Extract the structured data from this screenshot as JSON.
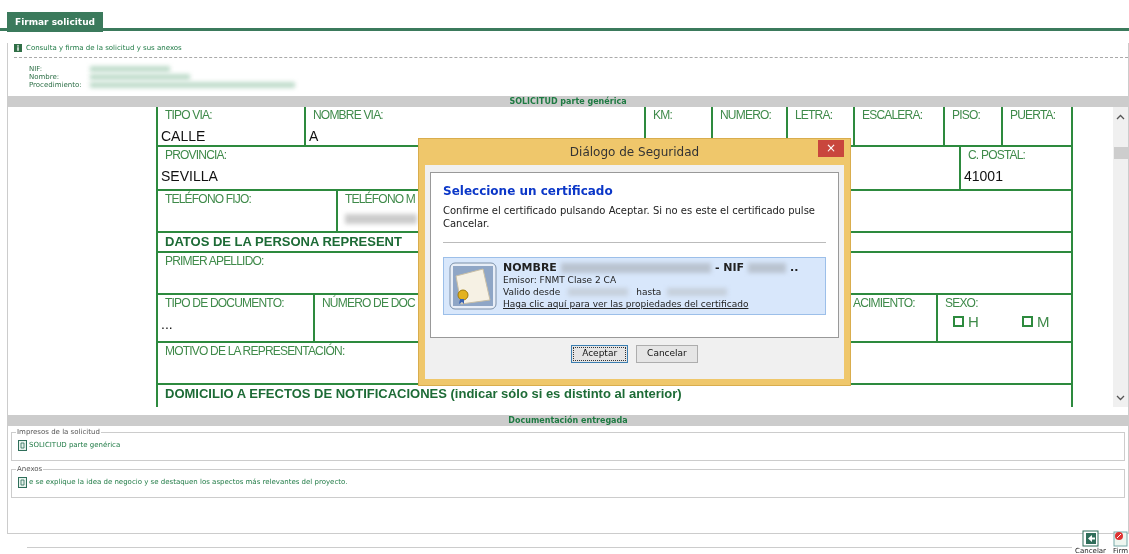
{
  "tab": {
    "label": "Firmar solicitud",
    "selected": true
  },
  "info": {
    "title": "Consulta y firma de la solicitud y sus anexos"
  },
  "applicant": {
    "labels": [
      "NIF:",
      "Nombre:",
      "Procedimiento:"
    ]
  },
  "section_header": "SOLICITUD parte genérica",
  "form": {
    "lines": [
      [
        {
          "kind": "field",
          "label": "TIPO VIA:",
          "value": "CALLE"
        },
        {
          "kind": "field",
          "label": "NOMBRE VIA:",
          "value": "A"
        },
        {
          "kind": "field",
          "label": "KM:"
        },
        {
          "kind": "field",
          "label": "NUMERO:"
        },
        {
          "kind": "field",
          "label": "LETRA:"
        },
        {
          "kind": "field",
          "label": "ESCALERA:"
        },
        {
          "kind": "field",
          "label": "PISO:"
        },
        {
          "kind": "field",
          "label": "PUERTA:"
        }
      ],
      [
        {
          "kind": "field",
          "label": "PROVINCIA:",
          "value": "SEVILLA"
        },
        {
          "kind": "field",
          "label": "C. POSTAL:",
          "value": "41001"
        }
      ],
      [
        {
          "kind": "field",
          "label": "TELÉFONO FIJO:"
        },
        {
          "kind": "redacted",
          "label": "TELÉFONO M"
        }
      ],
      [
        {
          "kind": "heading",
          "label": "DATOS DE LA PERSONA REPRESENT"
        }
      ],
      [
        {
          "kind": "field",
          "label": "PRIMER APELLIDO:"
        }
      ],
      [
        {
          "kind": "field",
          "label": "TIPO DE DOCUMENTO:",
          "value": "..."
        },
        {
          "kind": "field",
          "label": "NÚMERO DE DOC"
        },
        {
          "kind": "field",
          "label": "ACIMIENTO:"
        },
        {
          "kind": "checks",
          "label": "SEXO:",
          "options": [
            {
              "label": "H",
              "checked": false
            },
            {
              "label": "M",
              "checked": false
            }
          ]
        }
      ],
      [
        {
          "kind": "field",
          "label": "MOTIVO DE LA REPRESENTACIÓN:"
        }
      ],
      [
        {
          "kind": "heading",
          "label": "DOMICILIO A EFECTOS DE NOTIFICACIONES (indicar sólo si es distinto al anterior)"
        }
      ]
    ]
  },
  "dialog": {
    "title": "Diálogo de Seguridad",
    "close": "×",
    "heading": "Seleccione un certificado",
    "message": "Confirme el certificado pulsando Aceptar. Si no es este el certificado pulse Cancelar.",
    "certificate": {
      "name_label": "NOMBRE",
      "nif_label": "- NIF",
      "ellipsis": "..",
      "issuer": "Emisor: FNMT Clase 2 CA",
      "valid_from": "Valido desde",
      "valid_to": "hasta",
      "link": "Haga clic aquí para ver las propiedades del certificado"
    },
    "buttons": [
      {
        "label": "Aceptar",
        "focused": true
      },
      {
        "label": "Cancelar",
        "focused": false
      }
    ]
  },
  "docs": {
    "header": "Documentación entregada",
    "groups": [
      {
        "legend": "Impresos de la solicitud",
        "items": [
          "SOLICITUD parte genérica"
        ]
      },
      {
        "legend": "Anexos",
        "items": [
          "e se explique la idea de negocio y se destaquen los aspectos más relevantes del proyecto."
        ]
      }
    ]
  },
  "actions": [
    {
      "label": "Cancelar",
      "kind": "cancel"
    },
    {
      "label": "Firm",
      "kind": "sign"
    }
  ]
}
